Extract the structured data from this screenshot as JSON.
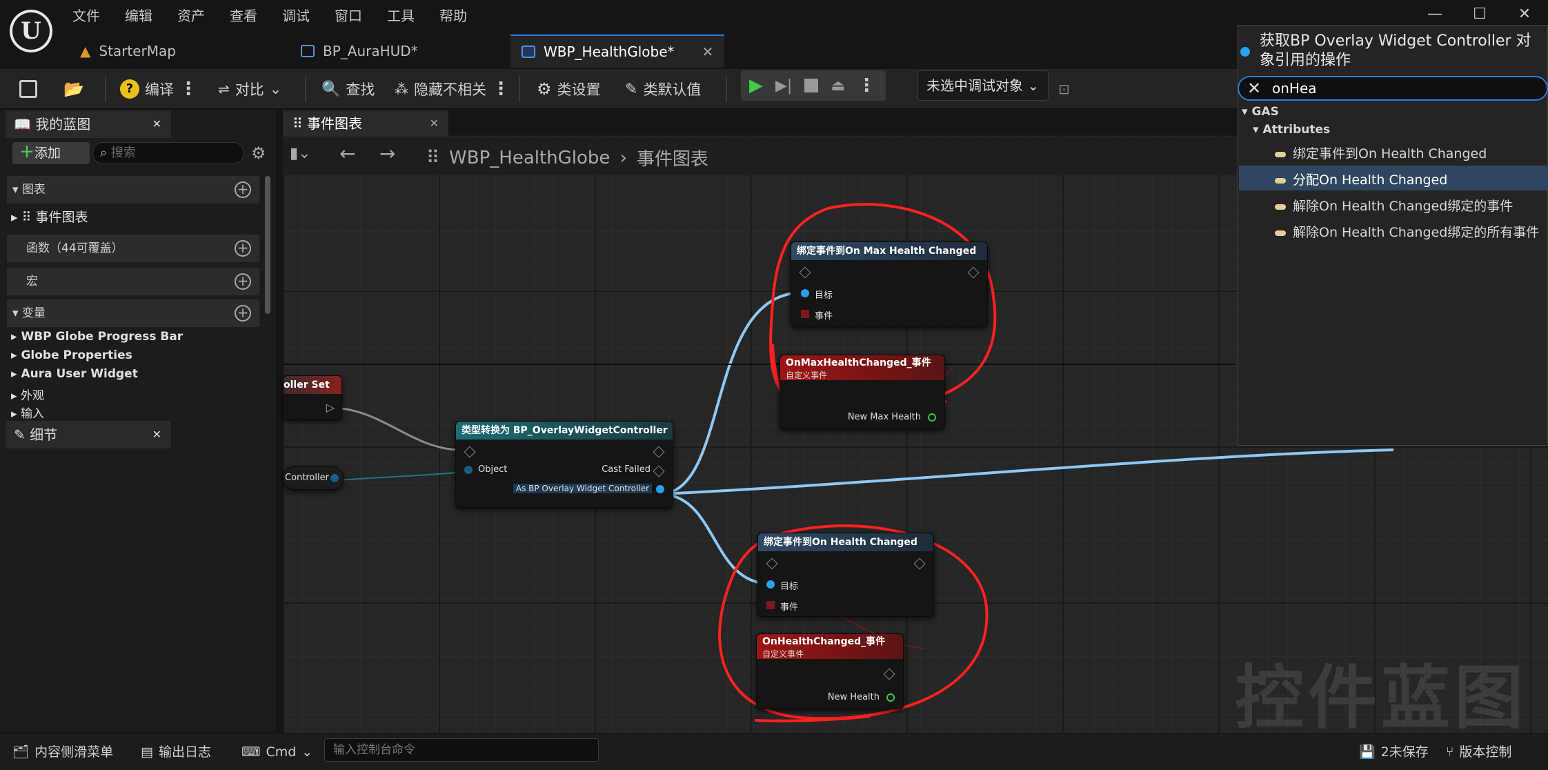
{
  "menu": [
    "文件",
    "编辑",
    "资产",
    "查看",
    "调试",
    "窗口",
    "工具",
    "帮助"
  ],
  "tabs": [
    {
      "label": "StarterMap"
    },
    {
      "label": "BP_AuraHUD*"
    },
    {
      "label": "WBP_HealthGlobe*"
    }
  ],
  "toolbar": {
    "compile": "编译",
    "diff": "对比",
    "find": "查找",
    "hide_unrelated": "隐藏不相关",
    "class_settings": "类设置",
    "class_defaults": "类默认值",
    "debug_object": "未选中调试对象"
  },
  "my_blueprint": {
    "tab": "我的蓝图",
    "add": "添加",
    "search_placeholder": "搜索",
    "sec_graphs": "图表",
    "event_graph": "事件图表",
    "functions": "函数（44可覆盖）",
    "macros": "宏",
    "variables": "变量",
    "var_items": [
      "WBP Globe Progress Bar",
      "Globe Properties",
      "Aura User Widget",
      "外观",
      "输入"
    ]
  },
  "details_tab": "细节",
  "graph": {
    "tab": "事件图表",
    "breadcrumb_root": "WBP_HealthGlobe",
    "breadcrumb_sep": "›",
    "breadcrumb_leaf": "事件图表",
    "watermark": "控件蓝图"
  },
  "nodes": {
    "set_partial": "oller Set",
    "controller_partial": "Controller",
    "cast_title": "类型转换为 BP_OverlayWidgetController",
    "cast_object": "Object",
    "cast_failed": "Cast Failed",
    "cast_out": "As BP Overlay Widget Controller",
    "bind_max_title": "绑定事件到On Max Health Changed",
    "bind_target": "目标",
    "bind_event": "事件",
    "ev_max_title": "OnMaxHealthChanged_事件",
    "ev_sub": "自定义事件",
    "ev_max_pin": "New Max Health",
    "bind_hp_title": "绑定事件到On Health Changed",
    "ev_hp_title": "OnHealthChanged_事件",
    "ev_hp_pin": "New Health"
  },
  "popup": {
    "title": "获取BP Overlay Widget Controller 对象引用的操作",
    "search_value": "onHea",
    "cat1": "GAS",
    "cat2": "Attributes",
    "items": [
      "绑定事件到On Health Changed",
      "分配On Health Changed",
      "解除On Health Changed绑定的事件",
      "解除On Health Changed绑定的所有事件"
    ]
  },
  "statusbar": {
    "content_drawer": "内容侧滑菜单",
    "output_log": "输出日志",
    "cmd": "Cmd",
    "cmd_placeholder": "输入控制台命令",
    "unsaved": "2未保存",
    "source_control": "版本控制"
  },
  "colors": {
    "accent": "#2a7de0",
    "annotation": "#ff2a2a",
    "wire_blue": "#8ec8f5"
  }
}
